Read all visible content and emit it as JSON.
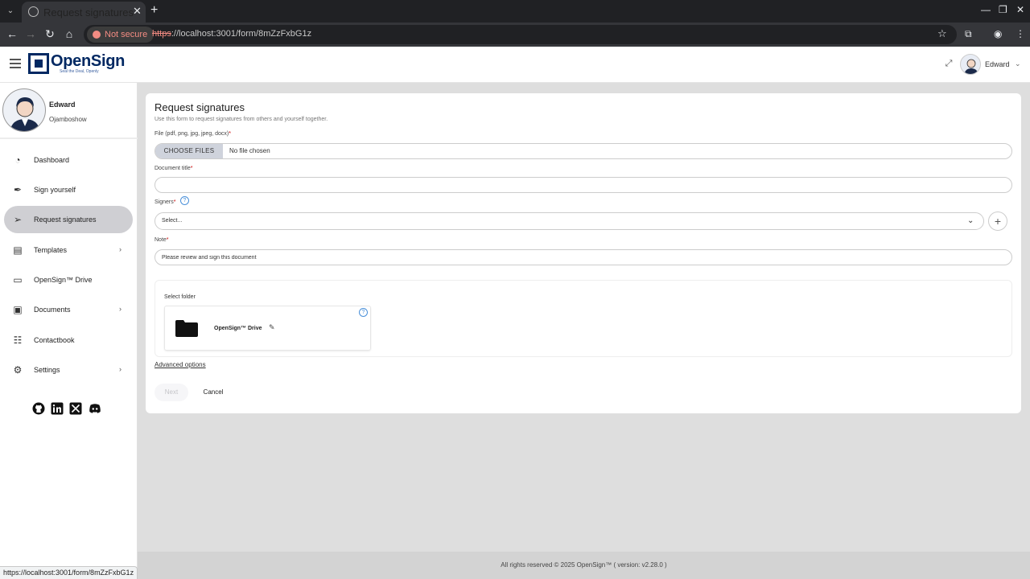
{
  "browser": {
    "tab_title": "Request signatures - OpenSign™",
    "security_label": "Not secure",
    "url_protocol": "https",
    "url_rest": "://localhost:3001/form/8mZzFxbG1z",
    "status_url": "https://localhost:3001/form/8mZzFxbG1z"
  },
  "header": {
    "logo_text": "OpenSign",
    "logo_tagline": "Seal the Deal, Openly",
    "user_name": "Edward"
  },
  "profile": {
    "name": "Edward",
    "subtitle": "Ojamboshow"
  },
  "sidebar": {
    "items": [
      {
        "label": "Dashboard",
        "icon": "dashboard-icon"
      },
      {
        "label": "Sign yourself",
        "icon": "pen-icon"
      },
      {
        "label": "Request signatures",
        "icon": "paper-plane-icon"
      },
      {
        "label": "Templates",
        "icon": "templates-icon"
      },
      {
        "label": "OpenSign™ Drive",
        "icon": "folder-icon"
      },
      {
        "label": "Documents",
        "icon": "documents-icon"
      },
      {
        "label": "Contactbook",
        "icon": "contactbook-icon"
      },
      {
        "label": "Settings",
        "icon": "gear-icon"
      }
    ],
    "active_index": 2,
    "social": [
      "github-icon",
      "linkedin-icon",
      "x-icon",
      "discord-icon"
    ]
  },
  "form": {
    "title": "Request signatures",
    "subtitle": "Use this form to request signatures from others and yourself together.",
    "file_label": "File (pdf, png, jpg, jpeg, docx)",
    "choose_files": "CHOOSE FILES",
    "no_file": "No file chosen",
    "document_title_label": "Document title",
    "document_title_value": "",
    "signers_label": "Signers",
    "signers_placeholder": "Select...",
    "note_label": "Note",
    "note_value": "Please review and sign this document",
    "select_folder_label": "Select folder",
    "folder_name": "OpenSign™ Drive",
    "advanced_options": "Advanced options",
    "next": "Next",
    "cancel": "Cancel",
    "required_mark": "*"
  },
  "footer": {
    "text": "All rights reserved © 2025  OpenSign™ ( version: v2.28.0 )"
  },
  "colors": {
    "brand": "#002862",
    "active_nav": "#cfcfd3",
    "help": "#4a90d9"
  }
}
